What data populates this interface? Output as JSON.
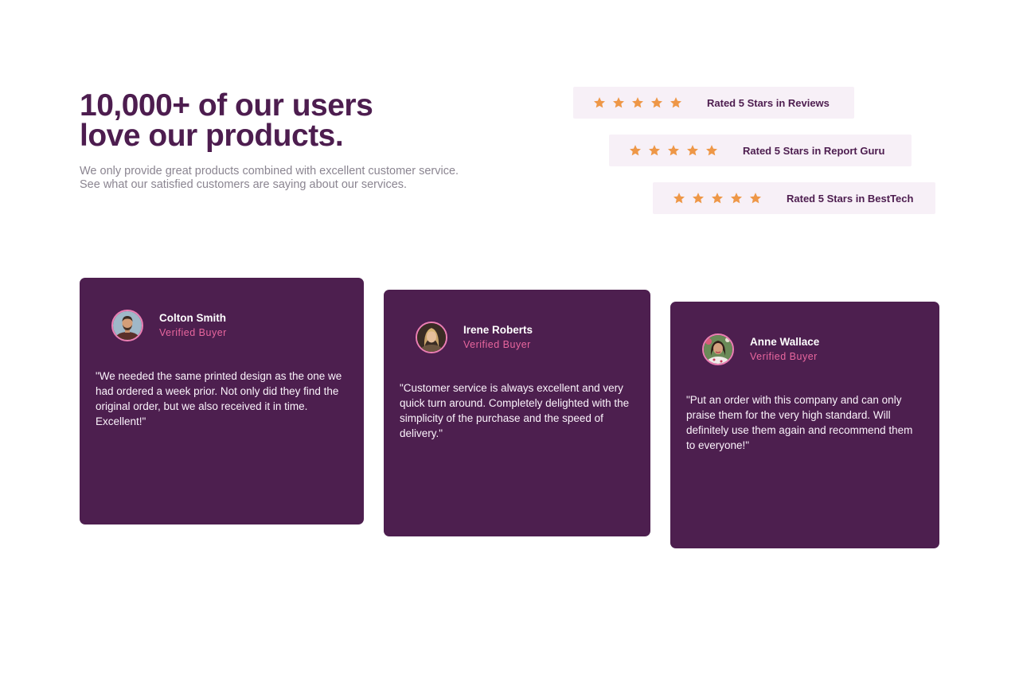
{
  "hero": {
    "title_line1": "10,000+ of our users",
    "title_line2": "love our products.",
    "intro": "We only provide great products combined with excellent customer service. See what our satisfied customers are saying about our services."
  },
  "ratings": [
    {
      "label": "Rated 5 Stars in Reviews",
      "stars": 5
    },
    {
      "label": "Rated 5 Stars in Report Guru",
      "stars": 5
    },
    {
      "label": "Rated 5 Stars in BestTech",
      "stars": 5
    }
  ],
  "testimonials": [
    {
      "name": "Colton Smith",
      "badge": "Verified Buyer",
      "quote": "\"We needed the same printed design as the one we had ordered a week prior. Not only did they find the original order, but we also received it in time. Excellent!\""
    },
    {
      "name": "Irene Roberts",
      "badge": "Verified Buyer",
      "quote": "\"Customer service is always excellent and very quick turn around. Completely delighted with the simplicity of the purchase and the speed of delivery.\""
    },
    {
      "name": "Anne Wallace",
      "badge": "Verified Buyer",
      "quote": "\"Put an order with this company and can only praise them for the very high standard. Will definitely use them again and recommend them to everyone!\""
    }
  ],
  "colors": {
    "brand_purple": "#4d1f4f",
    "star_orange": "#ee9747",
    "pink_accent": "#e8669e",
    "rating_bg": "#f7f0f7"
  },
  "icons": {
    "star": "star-icon",
    "avatar": "avatar"
  }
}
